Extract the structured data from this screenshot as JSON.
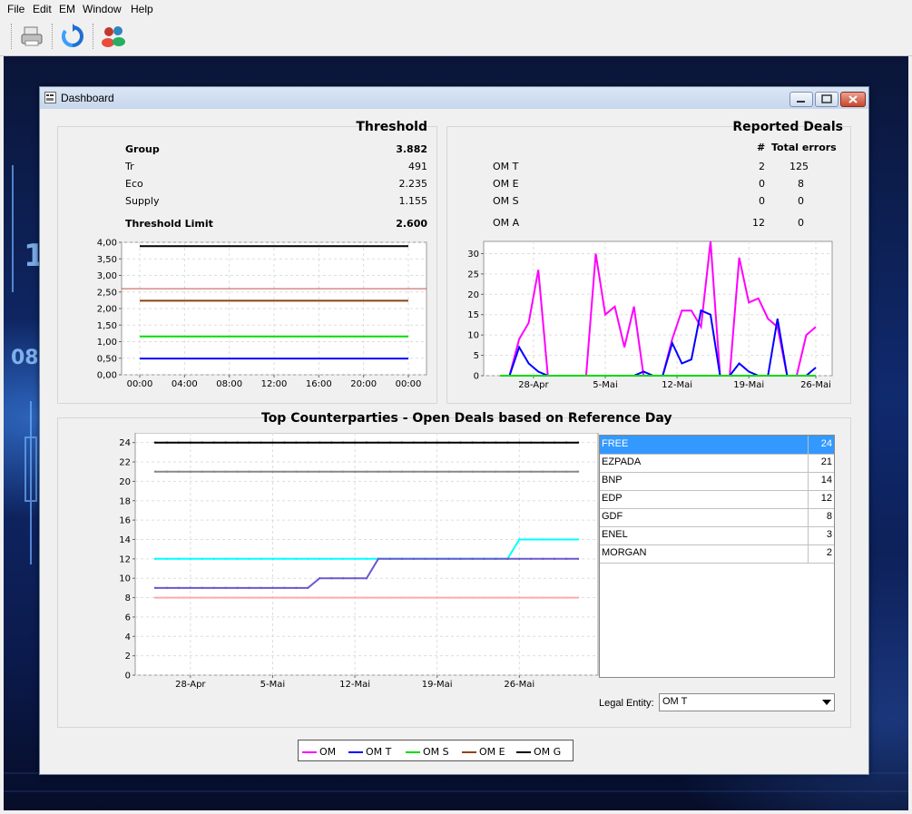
{
  "menu": [
    "File",
    "Edit",
    "EM",
    "Window",
    "Help"
  ],
  "window": {
    "title": "Dashboard"
  },
  "threshold": {
    "title": "Threshold",
    "rows": [
      {
        "label": "Group",
        "value": "3.882",
        "bold": true
      },
      {
        "label": "Tr",
        "value": "491",
        "bold": false
      },
      {
        "label": "Eco",
        "value": "2.235",
        "bold": false
      },
      {
        "label": "Supply",
        "value": "1.155",
        "bold": false
      }
    ],
    "limit": {
      "label": "Threshold Limit",
      "value": "2.600"
    }
  },
  "reported": {
    "title": "Reported Deals",
    "col_count": "#",
    "col_errors": "Total errors",
    "rows": [
      {
        "entity": "OM   T",
        "count": "2",
        "errors": "125"
      },
      {
        "entity": "OM   E",
        "count": "0",
        "errors": "8"
      },
      {
        "entity": "OM   S",
        "count": "0",
        "errors": "0"
      },
      {
        "entity": "OM   A",
        "count": "12",
        "errors": "0"
      }
    ]
  },
  "counterparties": {
    "title": "Top Counterparties - Open Deals based on Reference Day",
    "list": [
      {
        "name": "FREE",
        "value": "24",
        "selected": true
      },
      {
        "name": "EZPADA",
        "value": "21",
        "selected": false
      },
      {
        "name": "BNP",
        "value": "14",
        "selected": false
      },
      {
        "name": "EDP",
        "value": "12",
        "selected": false
      },
      {
        "name": "GDF",
        "value": "8",
        "selected": false
      },
      {
        "name": "ENEL",
        "value": "3",
        "selected": false
      },
      {
        "name": "MORGAN",
        "value": "2",
        "selected": false
      }
    ],
    "legal_entity_label": "Legal Entity:",
    "legal_entity_value": "OM   T"
  },
  "legend": [
    {
      "label": "OM",
      "color": "#ff00ff"
    },
    {
      "label": "OM   T",
      "color": "#0000ff"
    },
    {
      "label": "OM   S",
      "color": "#00dd00"
    },
    {
      "label": "OM   E",
      "color": "#8b4513"
    },
    {
      "label": "OM   G",
      "color": "#000000"
    }
  ],
  "chart_data": [
    {
      "type": "line",
      "title": "",
      "x": [
        "00:00",
        "04:00",
        "08:00",
        "12:00",
        "16:00",
        "20:00",
        "00:00"
      ],
      "ylim": [
        0,
        4
      ],
      "yticks": [
        "0,00",
        "0,50",
        "1,00",
        "1,50",
        "2,00",
        "2,50",
        "3,00",
        "3,50",
        "4,00"
      ],
      "grid": true,
      "series": [
        {
          "values": [
            3.882,
            3.882,
            3.882,
            3.882,
            3.882,
            3.882,
            3.882
          ],
          "color": "#000000"
        },
        {
          "values": [
            2.235,
            2.235,
            2.235,
            2.235,
            2.235,
            2.235,
            2.235
          ],
          "color": "#8b4513"
        },
        {
          "values": [
            1.155,
            1.155,
            1.155,
            1.155,
            1.155,
            1.155,
            1.155
          ],
          "color": "#00dd00"
        },
        {
          "values": [
            0.491,
            0.491,
            0.491,
            0.491,
            0.491,
            0.491,
            0.491
          ],
          "color": "#0000ff"
        }
      ],
      "reference_line": {
        "value": 2.6,
        "color": "#c0504d"
      }
    },
    {
      "type": "line",
      "title": "",
      "xticks": [
        "28-Apr",
        "5-Mai",
        "12-Mai",
        "19-Mai",
        "26-Mai"
      ],
      "ylim": [
        0,
        33
      ],
      "yticks": [
        "0",
        "5",
        "10",
        "15",
        "20",
        "25",
        "30"
      ],
      "grid": true,
      "series": [
        {
          "color": "#ff00ff",
          "values": [
            0,
            0,
            9,
            13,
            26,
            0,
            0,
            0,
            0,
            0,
            30,
            15,
            17,
            7,
            17,
            0,
            0,
            0,
            9,
            16,
            16,
            12,
            33,
            0,
            0,
            29,
            18,
            19,
            14,
            12,
            0,
            0,
            10,
            12
          ]
        },
        {
          "color": "#0000ff",
          "values": [
            0,
            0,
            7,
            3,
            1,
            0,
            0,
            0,
            0,
            0,
            0,
            0,
            0,
            0,
            0,
            1,
            0,
            0,
            8,
            3,
            4,
            16,
            15,
            0,
            0,
            3,
            1,
            0,
            0,
            14,
            0,
            0,
            0,
            2
          ]
        },
        {
          "color": "#00dd00",
          "values": [
            0,
            0,
            0,
            0,
            0,
            0,
            0,
            0,
            0,
            0,
            0,
            0,
            0,
            0,
            0,
            0,
            0,
            0,
            0,
            0,
            0,
            0,
            0,
            0,
            0,
            0,
            0,
            0,
            0,
            0,
            0,
            0,
            0,
            0
          ]
        }
      ]
    },
    {
      "type": "line",
      "title": "Top Counterparties - Open Deals based on Reference Day",
      "xticks": [
        "28-Apr",
        "5-Mai",
        "12-Mai",
        "19-Mai",
        "26-Mai"
      ],
      "ylim": [
        0,
        25
      ],
      "yticks": [
        "0",
        "2",
        "4",
        "6",
        "8",
        "10",
        "12",
        "14",
        "16",
        "18",
        "20",
        "22",
        "24"
      ],
      "grid": true,
      "series": [
        {
          "name": "FREE",
          "color": "#000000",
          "values": [
            24,
            24,
            24,
            24,
            24,
            24,
            24,
            24,
            24,
            24,
            24,
            24,
            24,
            24,
            24,
            24,
            24,
            24,
            24,
            24,
            24,
            24,
            24,
            24,
            24,
            24,
            24,
            24,
            24,
            24,
            24,
            24,
            24,
            24,
            24,
            24,
            24
          ]
        },
        {
          "name": "EZPADA",
          "color": "#888888",
          "values": [
            21,
            21,
            21,
            21,
            21,
            21,
            21,
            21,
            21,
            21,
            21,
            21,
            21,
            21,
            21,
            21,
            21,
            21,
            21,
            21,
            21,
            21,
            21,
            21,
            21,
            21,
            21,
            21,
            21,
            21,
            21,
            21,
            21,
            21,
            21,
            21,
            21
          ]
        },
        {
          "name": "BNP",
          "color": "#00ffff",
          "values": [
            12,
            12,
            12,
            12,
            12,
            12,
            12,
            12,
            12,
            12,
            12,
            12,
            12,
            12,
            12,
            12,
            12,
            12,
            12,
            12,
            12,
            12,
            12,
            12,
            12,
            12,
            12,
            12,
            12,
            12,
            12,
            14,
            14,
            14,
            14,
            14,
            14
          ]
        },
        {
          "name": "EDP",
          "color": "#6a5acd",
          "values": [
            9,
            9,
            9,
            9,
            9,
            9,
            9,
            9,
            9,
            9,
            9,
            9,
            9,
            9,
            10,
            10,
            10,
            10,
            10,
            12,
            12,
            12,
            12,
            12,
            12,
            12,
            12,
            12,
            12,
            12,
            12,
            12,
            12,
            12,
            12,
            12,
            12
          ]
        },
        {
          "name": "GDF",
          "color": "#ffaaaa",
          "values": [
            8,
            8,
            8,
            8,
            8,
            8,
            8,
            8,
            8,
            8,
            8,
            8,
            8,
            8,
            8,
            8,
            8,
            8,
            8,
            8,
            8,
            8,
            8,
            8,
            8,
            8,
            8,
            8,
            8,
            8,
            8,
            8,
            8,
            8,
            8,
            8,
            8
          ]
        }
      ]
    }
  ]
}
